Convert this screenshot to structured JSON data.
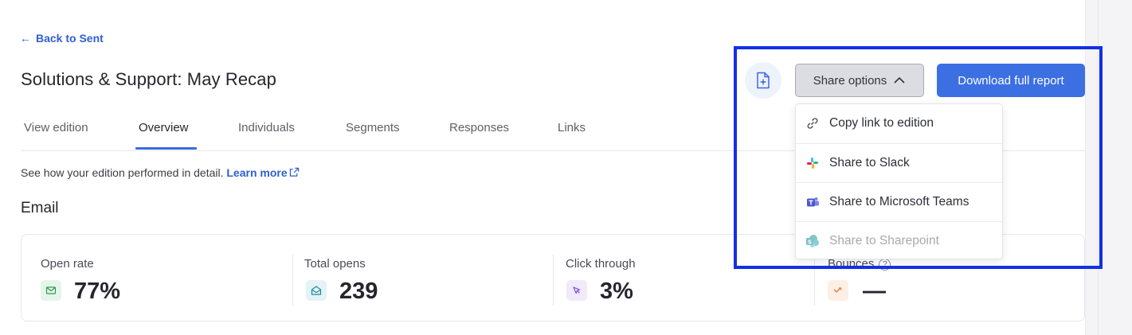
{
  "nav": {
    "back_link": "Back to Sent"
  },
  "page": {
    "title": "Solutions & Support: May Recap"
  },
  "tabs": [
    {
      "label": "View edition",
      "active": false
    },
    {
      "label": "Overview",
      "active": true
    },
    {
      "label": "Individuals",
      "active": false
    },
    {
      "label": "Segments",
      "active": false
    },
    {
      "label": "Responses",
      "active": false
    },
    {
      "label": "Links",
      "active": false
    }
  ],
  "intro": {
    "text": "See how your edition performed in detail.",
    "learn_more": "Learn more"
  },
  "section": {
    "title": "Email"
  },
  "stats": [
    {
      "label": "Open rate",
      "value": "77%",
      "icon": "mail-icon",
      "color": "#2f9a56"
    },
    {
      "label": "Total opens",
      "value": "239",
      "icon": "open-mail-icon",
      "color": "#1f8aa0"
    },
    {
      "label": "Click through",
      "value": "3%",
      "icon": "cursor-click-icon",
      "color": "#7a4fd6"
    },
    {
      "label": "Bounces",
      "help": "?",
      "value": "—",
      "icon": "bounce-arrow-icon",
      "color": "#e07a3a"
    }
  ],
  "actions": {
    "add_doc_icon": "file-plus-icon",
    "share_label": "Share options",
    "download_label": "Download full report"
  },
  "share_menu": {
    "items": [
      {
        "label": "Copy link to edition",
        "icon": "link-icon",
        "disabled": false
      },
      {
        "label": "Share to Slack",
        "icon": "slack-icon",
        "disabled": false
      },
      {
        "label": "Share to Microsoft Teams",
        "icon": "teams-icon",
        "disabled": false
      },
      {
        "label": "Share to Sharepoint",
        "icon": "sharepoint-icon",
        "disabled": true
      }
    ]
  },
  "colors": {
    "accent": "#3c6fe2",
    "link": "#2f5fd0",
    "highlight": "#1230e6"
  }
}
